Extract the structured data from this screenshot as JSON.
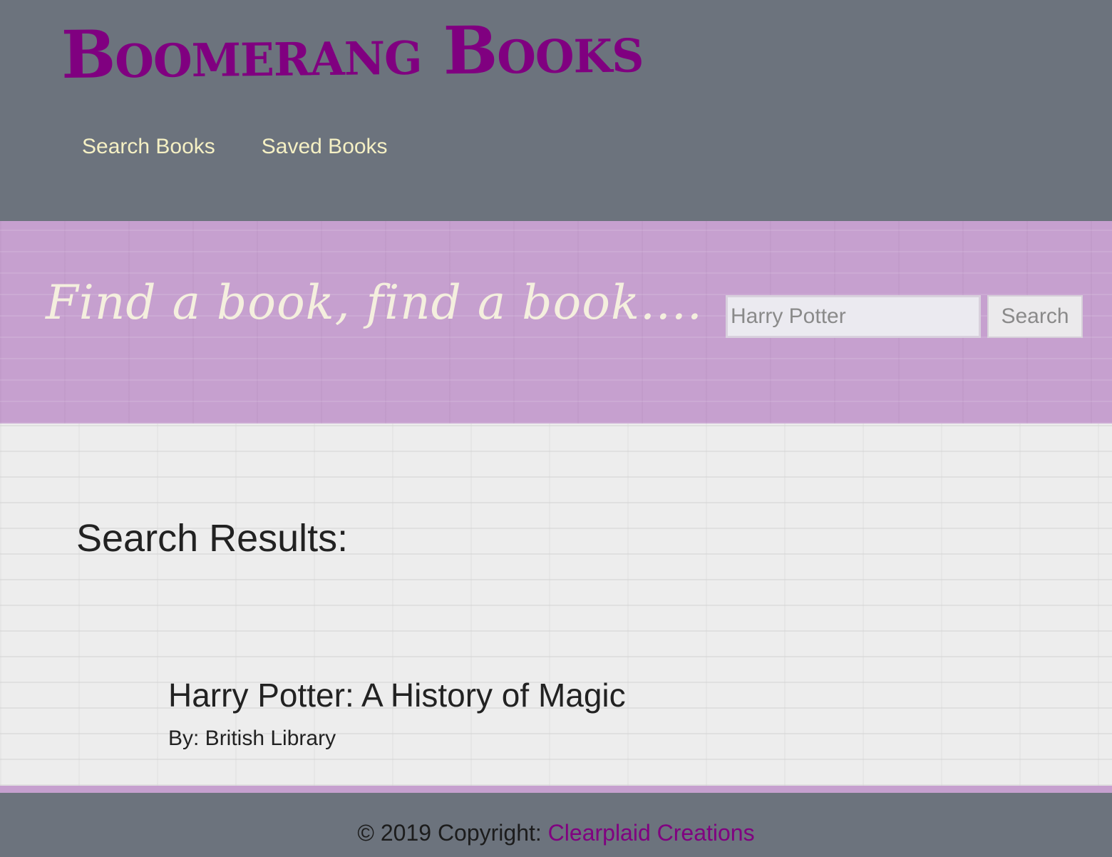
{
  "header": {
    "brand": "Boomerang Books",
    "nav": [
      "Search Books",
      "Saved Books"
    ]
  },
  "hero": {
    "tagline": "Find a book, find a book....",
    "search": {
      "value": "Harry Potter",
      "placeholder": "",
      "button_label": "Search"
    }
  },
  "main": {
    "heading": "Search Results:",
    "results": [
      {
        "title": "Harry Potter: A History of Magic",
        "author": "By: British Library"
      }
    ]
  },
  "footer": {
    "copyright": "© 2019 Copyright: ",
    "link": "Clearplaid Creations"
  },
  "colors": {
    "header_bg": "#6c737d",
    "brand": "#800080",
    "nav_text": "#f5f0c4",
    "hero_bg": "#c6a0cf",
    "tagline": "#f4efde",
    "link": "#800080"
  }
}
